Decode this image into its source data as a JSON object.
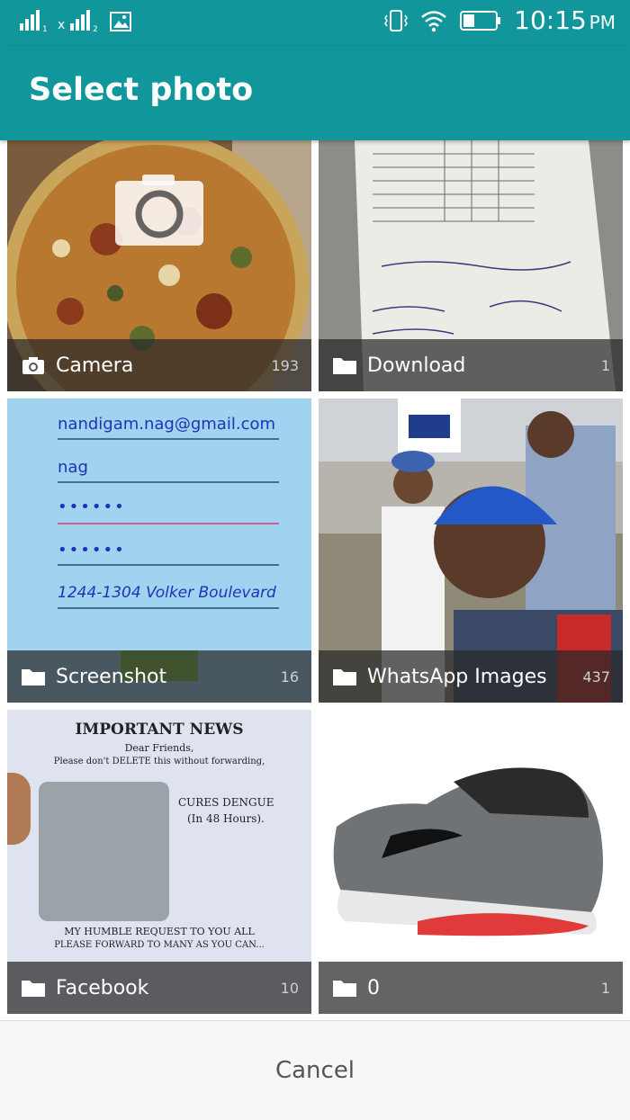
{
  "status_bar": {
    "time": "10:15",
    "ampm": "PM",
    "sim1_label": "1",
    "sim2_label": "2",
    "sim2_net": "x"
  },
  "header": {
    "title": "Select photo"
  },
  "albums": [
    {
      "name": "Camera",
      "count": "193",
      "icon": "camera-icon"
    },
    {
      "name": "Download",
      "count": "1",
      "icon": "folder-icon"
    },
    {
      "name": "Screenshot",
      "count": "16",
      "icon": "folder-icon"
    },
    {
      "name": "WhatsApp Images",
      "count": "437",
      "icon": "folder-icon"
    },
    {
      "name": "Facebook",
      "count": "10",
      "icon": "folder-icon"
    },
    {
      "name": "0",
      "count": "1",
      "icon": "folder-icon"
    }
  ],
  "thumb_text": {
    "screenshot_email": "nandigam.nag@gmail.com",
    "screenshot_user": "nag",
    "screenshot_pass1": "••••••",
    "screenshot_pass2": "••••••",
    "screenshot_address": "1244-1304 Volker Boulevard",
    "facebook_headline": "IMPORTANT NEWS",
    "facebook_line1": "Dear Friends,",
    "facebook_line2": "Please don't DELETE this without forwarding,",
    "facebook_line3": "CURES DENGUE",
    "facebook_line4": "(In 48 Hours).",
    "facebook_footer1": "MY HUMBLE REQUEST TO YOU ALL",
    "facebook_footer2": "PLEASE FORWARD TO MANY AS YOU CAN..."
  },
  "footer": {
    "cancel_label": "Cancel"
  },
  "colors": {
    "accent": "#11969b"
  }
}
